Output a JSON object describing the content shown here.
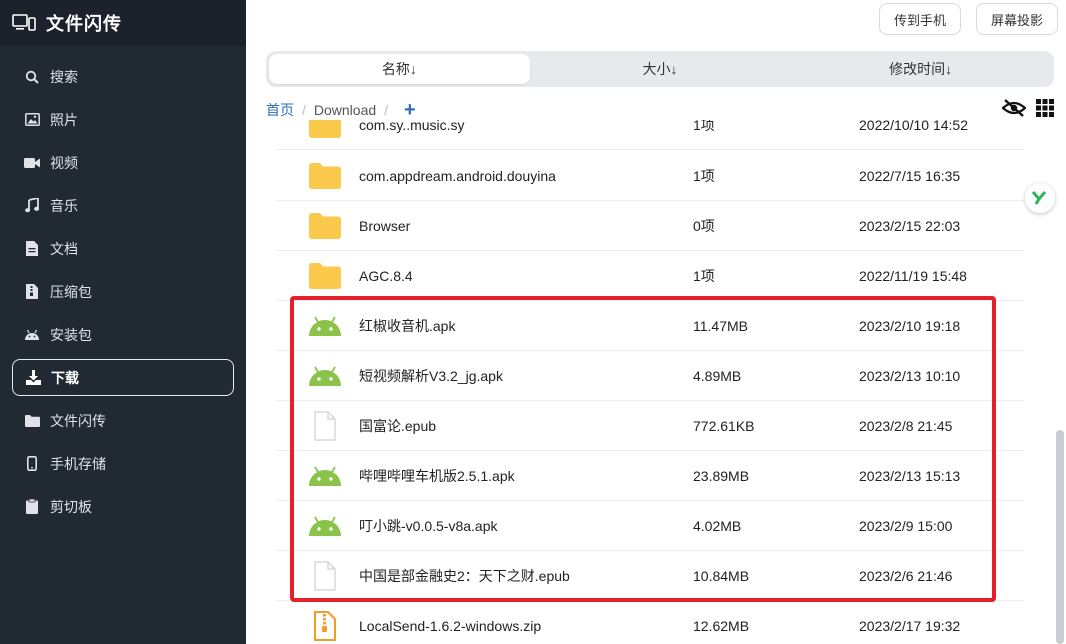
{
  "app": {
    "title": "文件闪传"
  },
  "sidebar": {
    "items": [
      {
        "label": "搜索",
        "icon": "search-icon"
      },
      {
        "label": "照片",
        "icon": "image-icon"
      },
      {
        "label": "视频",
        "icon": "video-icon"
      },
      {
        "label": "音乐",
        "icon": "music-icon"
      },
      {
        "label": "文档",
        "icon": "document-icon"
      },
      {
        "label": "压缩包",
        "icon": "archive-icon"
      },
      {
        "label": "安装包",
        "icon": "android-icon"
      },
      {
        "label": "下载",
        "icon": "download-icon",
        "active": true
      },
      {
        "label": "文件闪传",
        "icon": "folder-icon"
      },
      {
        "label": "手机存储",
        "icon": "phone-icon"
      },
      {
        "label": "剪切板",
        "icon": "clipboard-icon"
      }
    ]
  },
  "toolbar": {
    "send_to_phone": "传到手机",
    "screen_cast": "屏幕投影"
  },
  "sort": {
    "name": "名称↓",
    "size": "大小↓",
    "modified": "修改时间↓"
  },
  "breadcrumb": {
    "home": "首页",
    "sep": "/",
    "current": "Download",
    "add": "+"
  },
  "files": [
    {
      "name": "com.sy..music.sy",
      "size": "1项",
      "time": "2022/10/10 14:52",
      "type": "folder"
    },
    {
      "name": "com.appdream.android.douyina",
      "size": "1项",
      "time": "2022/7/15 16:35",
      "type": "folder"
    },
    {
      "name": "Browser",
      "size": "0项",
      "time": "2023/2/15 22:03",
      "type": "folder"
    },
    {
      "name": "AGC.8.4",
      "size": "1项",
      "time": "2022/11/19 15:48",
      "type": "folder"
    },
    {
      "name": "红椒收音机.apk",
      "size": "11.47MB",
      "time": "2023/2/10 19:18",
      "type": "apk"
    },
    {
      "name": "短视频解析V3.2_jg.apk",
      "size": "4.89MB",
      "time": "2023/2/13 10:10",
      "type": "apk"
    },
    {
      "name": "国富论.epub",
      "size": "772.61KB",
      "time": "2023/2/8 21:45",
      "type": "doc"
    },
    {
      "name": "哔哩哔哩车机版2.5.1.apk",
      "size": "23.89MB",
      "time": "2023/2/13 15:13",
      "type": "apk"
    },
    {
      "name": "叮小跳-v0.0.5-v8a.apk",
      "size": "4.02MB",
      "time": "2023/2/9 15:00",
      "type": "apk"
    },
    {
      "name": "中国是部金融史2：天下之财.epub",
      "size": "10.84MB",
      "time": "2023/2/6 21:46",
      "type": "doc"
    },
    {
      "name": "LocalSend-1.6.2-windows.zip",
      "size": "12.62MB",
      "time": "2023/2/17 19:32",
      "type": "zip"
    }
  ],
  "colors": {
    "sidebar_bg": "#212933",
    "accent": "#2f6fb3",
    "folder": "#fbc94b",
    "android": "#8bc34a",
    "highlight": "#e5202a"
  }
}
